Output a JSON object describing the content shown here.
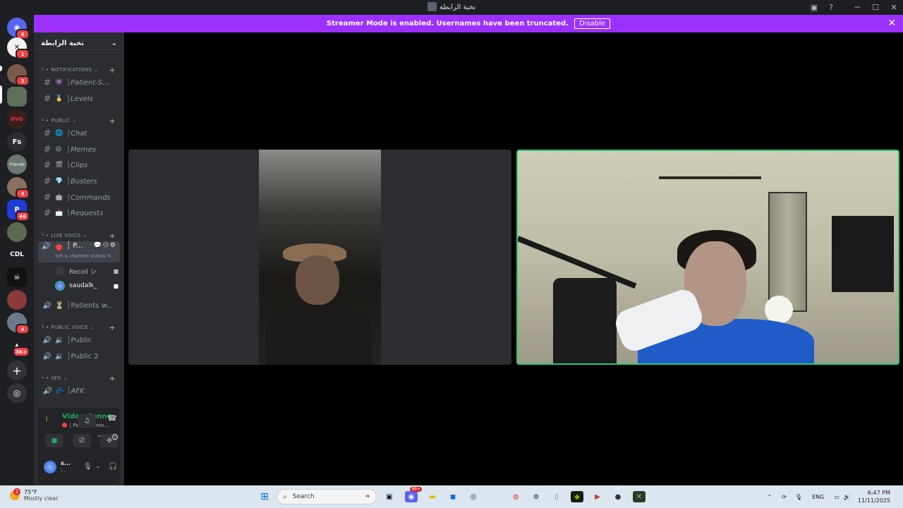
{
  "window": {
    "title": "نخبة الرابطة"
  },
  "banner": {
    "text": "Streamer Mode is enabled. Usernames have been truncated.",
    "disable_label": "Disable"
  },
  "guilds": {
    "home_badge": "6",
    "items": [
      {
        "badge": "1"
      },
      {
        "badge": "3"
      },
      {
        "badge": ""
      },
      {
        "badge": ""
      },
      {
        "label": "Fs",
        "badge": ""
      },
      {
        "label": "Friends",
        "badge": ""
      },
      {
        "badge": "4"
      },
      {
        "badge": "46"
      },
      {
        "badge": ""
      },
      {
        "label": "CDL",
        "badge": ""
      },
      {
        "badge": ""
      },
      {
        "badge": ""
      },
      {
        "badge": "4"
      },
      {
        "badge": "3K+"
      }
    ]
  },
  "server": {
    "name": "نخبة الرابطة",
    "categories": {
      "notifications": "NOTIFICATIONS",
      "public": "PUBLIC",
      "live_voice": "LIVE VOICE",
      "public_voice": "PUBLIC VOICE",
      "afk": "AFK"
    },
    "channels": {
      "patient": "Patient-S...",
      "levels": "Levels",
      "chat": "Chat",
      "memes": "Memes",
      "clips": "Clips",
      "bosters": "Bosters",
      "commands": "Commands",
      "requests": "Requests"
    },
    "live_voice": {
      "active_channel": "P...",
      "status_hint": "Set a channel status",
      "users": [
        {
          "name": "Recoil シ"
        },
        {
          "name": "saudalk_"
        }
      ],
      "waiting": "Patients w..."
    },
    "public_voice": [
      "Public",
      "Public 2"
    ],
    "afk_channel": "AFK"
  },
  "voice_panel": {
    "status": "Video Connected",
    "subtext": "Patient's roo...",
    "user": {
      "name": "s...",
      "sub": "i..."
    }
  },
  "taskbar": {
    "weather_badge": "2",
    "temp": "75°F",
    "condition": "Mostly clear",
    "search_placeholder": "Search",
    "discord_badge": "99+",
    "lang": "ENG",
    "time": "6:47 PM",
    "date": "11/11/2025"
  },
  "colors": {
    "banner": "#9b30ff",
    "connected": "#23a55a",
    "speaking_border": "#2dc770"
  }
}
